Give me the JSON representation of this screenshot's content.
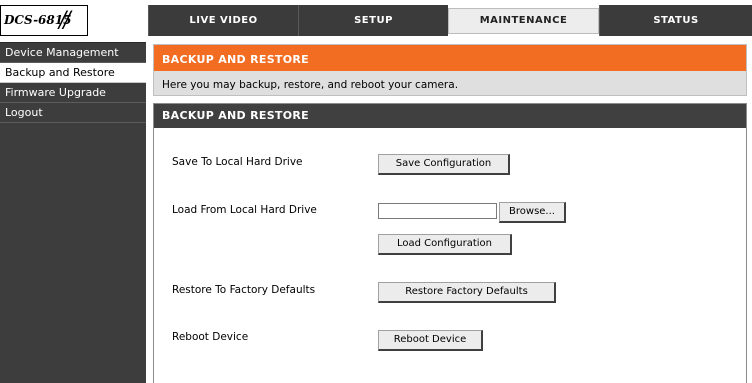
{
  "logo": {
    "model": "DCS-6815",
    "slashes": "//"
  },
  "nav": {
    "tabs": [
      {
        "label": "LIVE VIDEO"
      },
      {
        "label": "SETUP"
      },
      {
        "label": "MAINTENANCE"
      },
      {
        "label": "STATUS"
      }
    ]
  },
  "sidebar": {
    "items": [
      {
        "label": "Device Management"
      },
      {
        "label": "Backup and Restore"
      },
      {
        "label": "Firmware Upgrade"
      },
      {
        "label": "Logout"
      }
    ]
  },
  "intro": {
    "title": "BACKUP AND RESTORE",
    "description": "Here you may backup, restore, and reboot your camera."
  },
  "section": {
    "title": "BACKUP AND RESTORE",
    "save_label": "Save To Local Hard Drive",
    "save_button": "Save Configuration",
    "load_label": "Load From Local Hard Drive",
    "file_value": "",
    "browse_button": "Browse...",
    "load_button": "Load Configuration",
    "restore_label": "Restore To Factory Defaults",
    "restore_button": "Restore Factory Defaults",
    "reboot_label": "Reboot Device",
    "reboot_button": "Reboot Device"
  },
  "colors": {
    "accent": "#f26c21",
    "nav_bg": "#3b3b3b",
    "sidebar_bg": "#3d3d3d",
    "section_header_bg": "#404040"
  }
}
